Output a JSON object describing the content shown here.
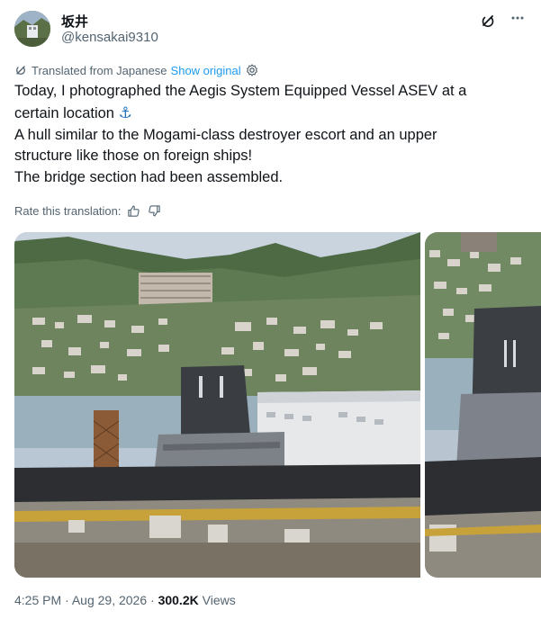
{
  "author": {
    "display_name": "坂井",
    "handle": "@kensakai9310"
  },
  "icons": {
    "grok": "grok-icon",
    "more": "more-icon",
    "translate": "translate-icon",
    "gear": "gear-icon",
    "thumbs_up": "thumbs-up-icon",
    "thumbs_down": "thumbs-down-icon",
    "anchor": "⚓"
  },
  "translation": {
    "label": "Translated from Japanese",
    "show_original": "Show original",
    "rate_label": "Rate this translation:"
  },
  "tweet": {
    "lines": [
      "Today, I photographed the Aegis System Equipped Vessel ASEV at a",
      "certain location",
      "A hull similar to the Mogami-class destroyer escort and an upper",
      "structure like those on foreign ships!",
      "The bridge section had been assembled."
    ]
  },
  "meta": {
    "time": "4:25 PM",
    "sep1": "·",
    "date": "Aug 29, 2026",
    "sep2": "·",
    "views_count": "300.2K",
    "views_label": "Views"
  },
  "colors": {
    "link": "#1d9bf0",
    "secondary_text": "#536471",
    "primary_text": "#0f1419"
  }
}
